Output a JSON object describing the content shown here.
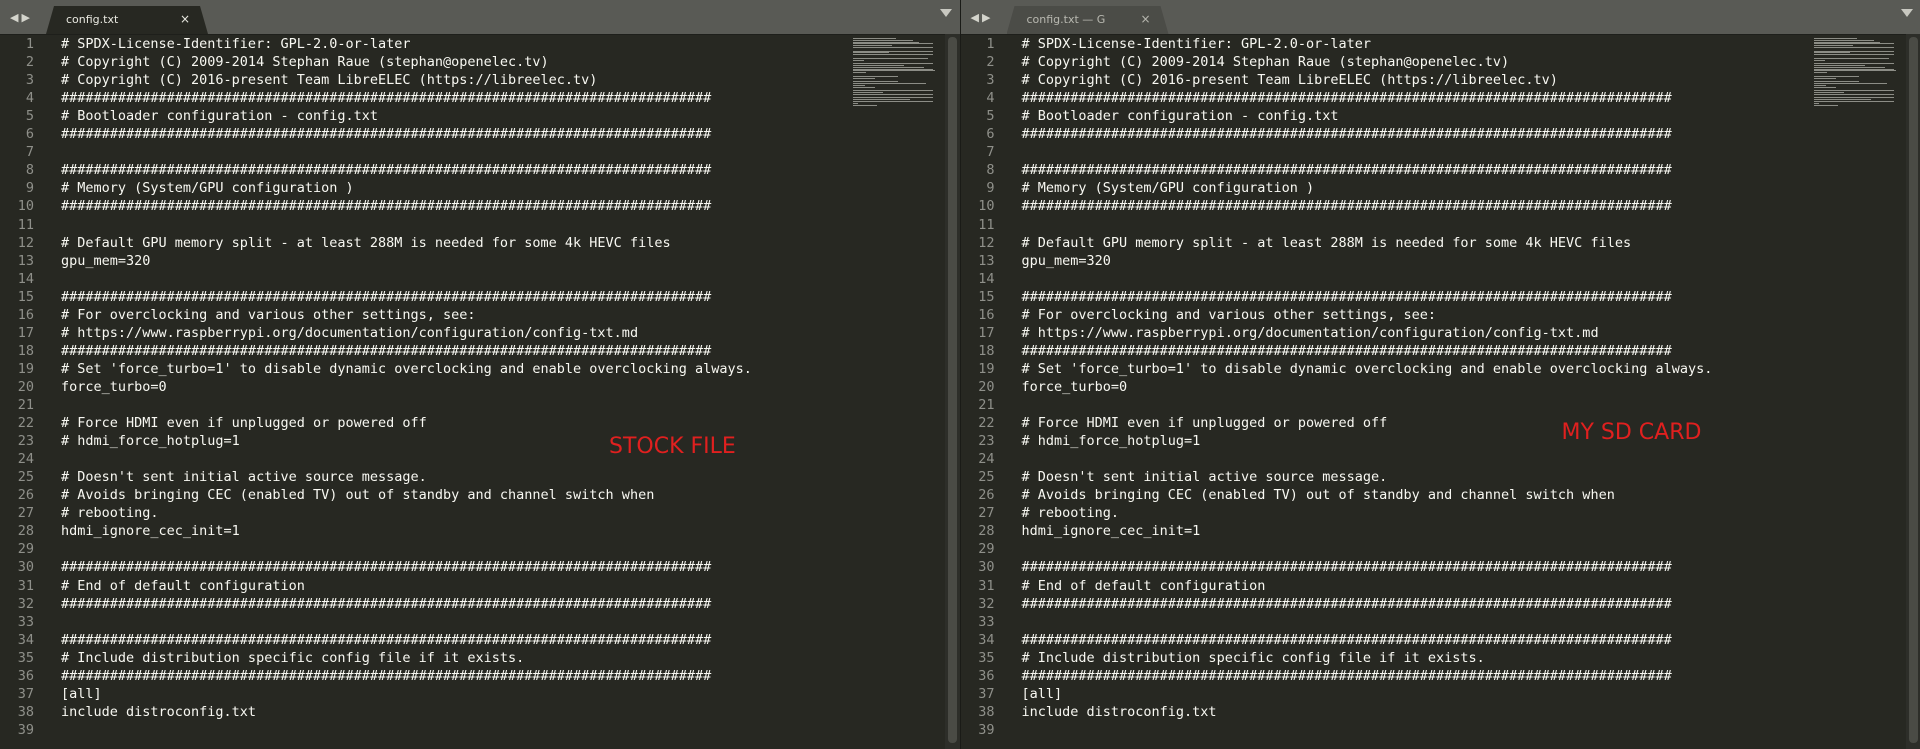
{
  "left_pane": {
    "tab_title": "config.txt",
    "tab_close": "×",
    "annotation": "STOCK FILE"
  },
  "right_pane": {
    "tab_title": "config.txt — G",
    "tab_close": "×",
    "annotation": "MY SD CARD"
  },
  "nav": {
    "back": "◀",
    "forward": "▶"
  },
  "line_numbers": [
    "1",
    "2",
    "3",
    "4",
    "5",
    "6",
    "7",
    "8",
    "9",
    "10",
    "11",
    "12",
    "13",
    "14",
    "15",
    "16",
    "17",
    "18",
    "19",
    "20",
    "21",
    "22",
    "23",
    "24",
    "25",
    "26",
    "27",
    "28",
    "29",
    "30",
    "31",
    "32",
    "33",
    "34",
    "35",
    "36",
    "37",
    "38",
    "39"
  ],
  "lines": [
    "# SPDX-License-Identifier: GPL-2.0-or-later",
    "# Copyright (C) 2009-2014 Stephan Raue (stephan@openelec.tv)",
    "# Copyright (C) 2016-present Team LibreELEC (https://libreelec.tv)",
    "################################################################################",
    "# Bootloader configuration - config.txt",
    "################################################################################",
    "",
    "################################################################################",
    "# Memory (System/GPU configuration )",
    "################################################################################",
    "",
    "# Default GPU memory split - at least 288M is needed for some 4k HEVC files",
    "gpu_mem=320",
    "",
    "################################################################################",
    "# For overclocking and various other settings, see:",
    "# https://www.raspberrypi.org/documentation/configuration/config-txt.md",
    "################################################################################",
    "# Set 'force_turbo=1' to disable dynamic overclocking and enable overclocking always.",
    "force_turbo=0",
    "",
    "# Force HDMI even if unplugged or powered off",
    "# hdmi_force_hotplug=1",
    "",
    "# Doesn't sent initial active source message.",
    "# Avoids bringing CEC (enabled TV) out of standby and channel switch when",
    "# rebooting.",
    "hdmi_ignore_cec_init=1",
    "",
    "################################################################################",
    "# End of default configuration",
    "################################################################################",
    "",
    "################################################################################",
    "# Include distribution specific config file if it exists.",
    "################################################################################",
    "[all]",
    "include distroconfig.txt",
    ""
  ],
  "colors": {
    "editor_bg": "#272822",
    "text": "#f8f8f2",
    "gutter_text": "#8f908a",
    "tabbar_bg": "#595a55",
    "annotation": "#e0201f"
  }
}
